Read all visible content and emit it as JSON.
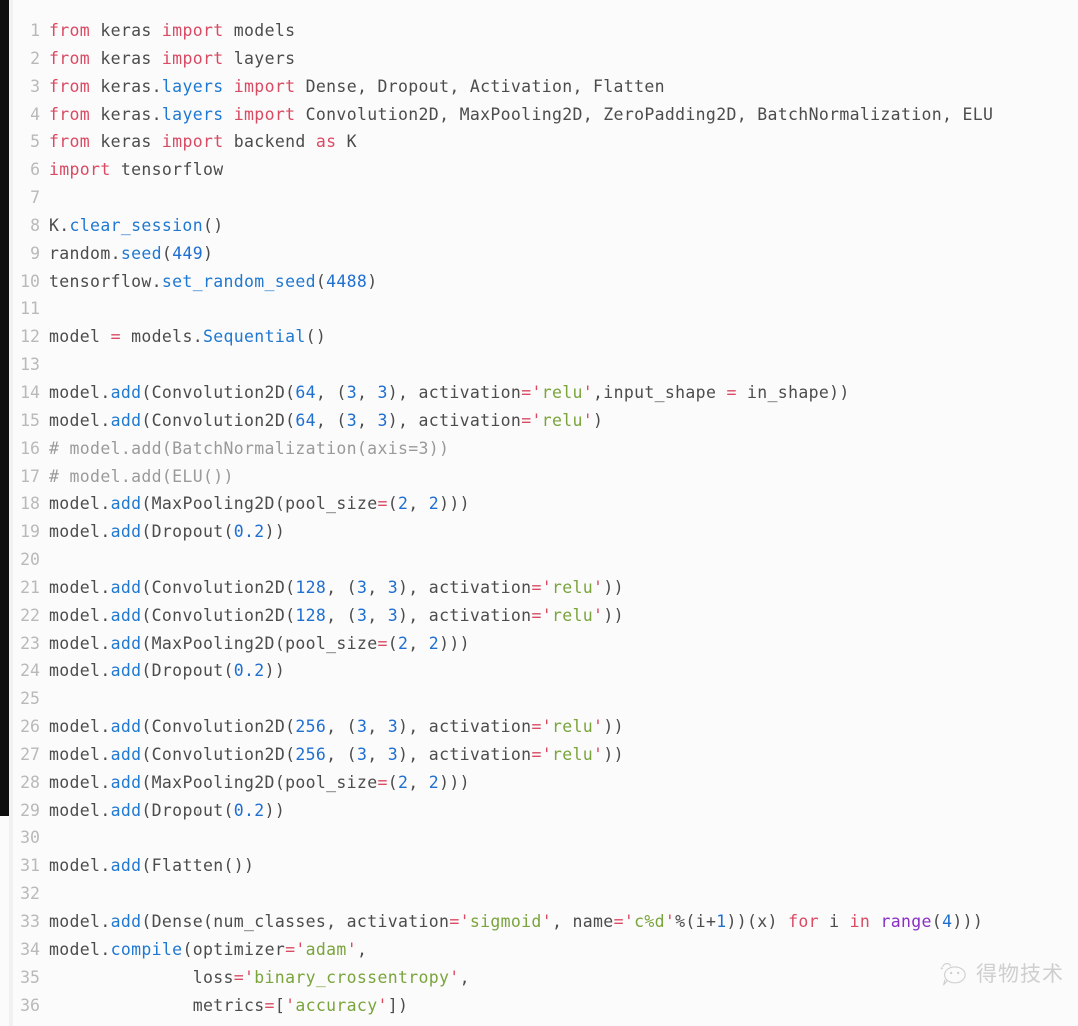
{
  "editor": {
    "language": "python",
    "theme_background": "#fbfbfb",
    "gutter_color": "#b9b9b9",
    "colors": {
      "keyword": "#d94a63",
      "function": "#1f78d1",
      "number": "#1f6fd1",
      "string": "#7aa43c",
      "comment": "#9a9a9a",
      "builtin": "#8a2fc4",
      "plain": "#4c4c4c",
      "left_bar": "#0e0e0e"
    },
    "first_line_number": 1,
    "last_line_number": 36,
    "total_lines": 36
  },
  "lines": [
    {
      "n": "1",
      "tokens": [
        {
          "t": "from",
          "c": "kw"
        },
        {
          "t": " keras ",
          "c": "pl"
        },
        {
          "t": "import",
          "c": "kw"
        },
        {
          "t": " models",
          "c": "pl"
        }
      ]
    },
    {
      "n": "2",
      "tokens": [
        {
          "t": "from",
          "c": "kw"
        },
        {
          "t": " keras ",
          "c": "pl"
        },
        {
          "t": "import",
          "c": "kw"
        },
        {
          "t": " layers",
          "c": "pl"
        }
      ]
    },
    {
      "n": "3",
      "tokens": [
        {
          "t": "from",
          "c": "kw"
        },
        {
          "t": " keras.",
          "c": "pl"
        },
        {
          "t": "layers",
          "c": "fn"
        },
        {
          "t": " ",
          "c": "pl"
        },
        {
          "t": "import",
          "c": "kw"
        },
        {
          "t": " Dense, Dropout, Activation, Flatten",
          "c": "pl"
        }
      ]
    },
    {
      "n": "4",
      "tokens": [
        {
          "t": "from",
          "c": "kw"
        },
        {
          "t": " keras.",
          "c": "pl"
        },
        {
          "t": "layers",
          "c": "fn"
        },
        {
          "t": " ",
          "c": "pl"
        },
        {
          "t": "import",
          "c": "kw"
        },
        {
          "t": " Convolution2D, MaxPooling2D, ZeroPadding2D, BatchNormalization, ELU",
          "c": "pl"
        }
      ]
    },
    {
      "n": "5",
      "tokens": [
        {
          "t": "from",
          "c": "kw"
        },
        {
          "t": " keras ",
          "c": "pl"
        },
        {
          "t": "import",
          "c": "kw"
        },
        {
          "t": " backend ",
          "c": "pl"
        },
        {
          "t": "as",
          "c": "kw"
        },
        {
          "t": " K",
          "c": "pl"
        }
      ]
    },
    {
      "n": "6",
      "tokens": [
        {
          "t": "import",
          "c": "kw"
        },
        {
          "t": " tensorflow",
          "c": "pl"
        }
      ]
    },
    {
      "n": "7",
      "tokens": []
    },
    {
      "n": "8",
      "tokens": [
        {
          "t": "K.",
          "c": "pl"
        },
        {
          "t": "clear_session",
          "c": "fn"
        },
        {
          "t": "()",
          "c": "pl"
        }
      ]
    },
    {
      "n": "9",
      "tokens": [
        {
          "t": "random.",
          "c": "pl"
        },
        {
          "t": "seed",
          "c": "fn"
        },
        {
          "t": "(",
          "c": "pl"
        },
        {
          "t": "449",
          "c": "num"
        },
        {
          "t": ")",
          "c": "pl"
        }
      ]
    },
    {
      "n": "10",
      "tokens": [
        {
          "t": "tensorflow.",
          "c": "pl"
        },
        {
          "t": "set_random_seed",
          "c": "fn"
        },
        {
          "t": "(",
          "c": "pl"
        },
        {
          "t": "4488",
          "c": "num"
        },
        {
          "t": ")",
          "c": "pl"
        }
      ]
    },
    {
      "n": "11",
      "tokens": []
    },
    {
      "n": "12",
      "tokens": [
        {
          "t": "model ",
          "c": "pl"
        },
        {
          "t": "=",
          "c": "op"
        },
        {
          "t": " models.",
          "c": "pl"
        },
        {
          "t": "Sequential",
          "c": "fn"
        },
        {
          "t": "()",
          "c": "pl"
        }
      ]
    },
    {
      "n": "13",
      "tokens": []
    },
    {
      "n": "14",
      "tokens": [
        {
          "t": "model.",
          "c": "pl"
        },
        {
          "t": "add",
          "c": "fn"
        },
        {
          "t": "(Convolution2D(",
          "c": "pl"
        },
        {
          "t": "64",
          "c": "num"
        },
        {
          "t": ", (",
          "c": "pl"
        },
        {
          "t": "3",
          "c": "num"
        },
        {
          "t": ", ",
          "c": "pl"
        },
        {
          "t": "3",
          "c": "num"
        },
        {
          "t": "), activation",
          "c": "pl"
        },
        {
          "t": "=",
          "c": "op"
        },
        {
          "t": "'",
          "c": "q"
        },
        {
          "t": "relu",
          "c": "str"
        },
        {
          "t": "'",
          "c": "q"
        },
        {
          "t": ",input_shape ",
          "c": "pl"
        },
        {
          "t": "=",
          "c": "op"
        },
        {
          "t": " in_shape))",
          "c": "pl"
        }
      ]
    },
    {
      "n": "15",
      "tokens": [
        {
          "t": "model.",
          "c": "pl"
        },
        {
          "t": "add",
          "c": "fn"
        },
        {
          "t": "(Convolution2D(",
          "c": "pl"
        },
        {
          "t": "64",
          "c": "num"
        },
        {
          "t": ", (",
          "c": "pl"
        },
        {
          "t": "3",
          "c": "num"
        },
        {
          "t": ", ",
          "c": "pl"
        },
        {
          "t": "3",
          "c": "num"
        },
        {
          "t": "), activation",
          "c": "pl"
        },
        {
          "t": "=",
          "c": "op"
        },
        {
          "t": "'",
          "c": "q"
        },
        {
          "t": "relu",
          "c": "str"
        },
        {
          "t": "'",
          "c": "q"
        },
        {
          "t": ")",
          "c": "pl"
        }
      ]
    },
    {
      "n": "16",
      "tokens": [
        {
          "t": "# model.add(BatchNormalization(axis=3))",
          "c": "com"
        }
      ]
    },
    {
      "n": "17",
      "tokens": [
        {
          "t": "# model.add(ELU())",
          "c": "com"
        }
      ]
    },
    {
      "n": "18",
      "tokens": [
        {
          "t": "model.",
          "c": "pl"
        },
        {
          "t": "add",
          "c": "fn"
        },
        {
          "t": "(MaxPooling2D(pool_size",
          "c": "pl"
        },
        {
          "t": "=",
          "c": "op"
        },
        {
          "t": "(",
          "c": "pl"
        },
        {
          "t": "2",
          "c": "num"
        },
        {
          "t": ", ",
          "c": "pl"
        },
        {
          "t": "2",
          "c": "num"
        },
        {
          "t": ")))",
          "c": "pl"
        }
      ]
    },
    {
      "n": "19",
      "tokens": [
        {
          "t": "model.",
          "c": "pl"
        },
        {
          "t": "add",
          "c": "fn"
        },
        {
          "t": "(Dropout(",
          "c": "pl"
        },
        {
          "t": "0.2",
          "c": "num"
        },
        {
          "t": "))",
          "c": "pl"
        }
      ]
    },
    {
      "n": "20",
      "tokens": []
    },
    {
      "n": "21",
      "tokens": [
        {
          "t": "model.",
          "c": "pl"
        },
        {
          "t": "add",
          "c": "fn"
        },
        {
          "t": "(Convolution2D(",
          "c": "pl"
        },
        {
          "t": "128",
          "c": "num"
        },
        {
          "t": ", (",
          "c": "pl"
        },
        {
          "t": "3",
          "c": "num"
        },
        {
          "t": ", ",
          "c": "pl"
        },
        {
          "t": "3",
          "c": "num"
        },
        {
          "t": "), activation",
          "c": "pl"
        },
        {
          "t": "=",
          "c": "op"
        },
        {
          "t": "'",
          "c": "q"
        },
        {
          "t": "relu",
          "c": "str"
        },
        {
          "t": "'",
          "c": "q"
        },
        {
          "t": "))",
          "c": "pl"
        }
      ]
    },
    {
      "n": "22",
      "tokens": [
        {
          "t": "model.",
          "c": "pl"
        },
        {
          "t": "add",
          "c": "fn"
        },
        {
          "t": "(Convolution2D(",
          "c": "pl"
        },
        {
          "t": "128",
          "c": "num"
        },
        {
          "t": ", (",
          "c": "pl"
        },
        {
          "t": "3",
          "c": "num"
        },
        {
          "t": ", ",
          "c": "pl"
        },
        {
          "t": "3",
          "c": "num"
        },
        {
          "t": "), activation",
          "c": "pl"
        },
        {
          "t": "=",
          "c": "op"
        },
        {
          "t": "'",
          "c": "q"
        },
        {
          "t": "relu",
          "c": "str"
        },
        {
          "t": "'",
          "c": "q"
        },
        {
          "t": "))",
          "c": "pl"
        }
      ]
    },
    {
      "n": "23",
      "tokens": [
        {
          "t": "model.",
          "c": "pl"
        },
        {
          "t": "add",
          "c": "fn"
        },
        {
          "t": "(MaxPooling2D(pool_size",
          "c": "pl"
        },
        {
          "t": "=",
          "c": "op"
        },
        {
          "t": "(",
          "c": "pl"
        },
        {
          "t": "2",
          "c": "num"
        },
        {
          "t": ", ",
          "c": "pl"
        },
        {
          "t": "2",
          "c": "num"
        },
        {
          "t": ")))",
          "c": "pl"
        }
      ]
    },
    {
      "n": "24",
      "tokens": [
        {
          "t": "model.",
          "c": "pl"
        },
        {
          "t": "add",
          "c": "fn"
        },
        {
          "t": "(Dropout(",
          "c": "pl"
        },
        {
          "t": "0.2",
          "c": "num"
        },
        {
          "t": "))",
          "c": "pl"
        }
      ]
    },
    {
      "n": "25",
      "tokens": []
    },
    {
      "n": "26",
      "tokens": [
        {
          "t": "model.",
          "c": "pl"
        },
        {
          "t": "add",
          "c": "fn"
        },
        {
          "t": "(Convolution2D(",
          "c": "pl"
        },
        {
          "t": "256",
          "c": "num"
        },
        {
          "t": ", (",
          "c": "pl"
        },
        {
          "t": "3",
          "c": "num"
        },
        {
          "t": ", ",
          "c": "pl"
        },
        {
          "t": "3",
          "c": "num"
        },
        {
          "t": "), activation",
          "c": "pl"
        },
        {
          "t": "=",
          "c": "op"
        },
        {
          "t": "'",
          "c": "q"
        },
        {
          "t": "relu",
          "c": "str"
        },
        {
          "t": "'",
          "c": "q"
        },
        {
          "t": "))",
          "c": "pl"
        }
      ]
    },
    {
      "n": "27",
      "tokens": [
        {
          "t": "model.",
          "c": "pl"
        },
        {
          "t": "add",
          "c": "fn"
        },
        {
          "t": "(Convolution2D(",
          "c": "pl"
        },
        {
          "t": "256",
          "c": "num"
        },
        {
          "t": ", (",
          "c": "pl"
        },
        {
          "t": "3",
          "c": "num"
        },
        {
          "t": ", ",
          "c": "pl"
        },
        {
          "t": "3",
          "c": "num"
        },
        {
          "t": "), activation",
          "c": "pl"
        },
        {
          "t": "=",
          "c": "op"
        },
        {
          "t": "'",
          "c": "q"
        },
        {
          "t": "relu",
          "c": "str"
        },
        {
          "t": "'",
          "c": "q"
        },
        {
          "t": "))",
          "c": "pl"
        }
      ]
    },
    {
      "n": "28",
      "tokens": [
        {
          "t": "model.",
          "c": "pl"
        },
        {
          "t": "add",
          "c": "fn"
        },
        {
          "t": "(MaxPooling2D(pool_size",
          "c": "pl"
        },
        {
          "t": "=",
          "c": "op"
        },
        {
          "t": "(",
          "c": "pl"
        },
        {
          "t": "2",
          "c": "num"
        },
        {
          "t": ", ",
          "c": "pl"
        },
        {
          "t": "2",
          "c": "num"
        },
        {
          "t": ")))",
          "c": "pl"
        }
      ]
    },
    {
      "n": "29",
      "tokens": [
        {
          "t": "model.",
          "c": "pl"
        },
        {
          "t": "add",
          "c": "fn"
        },
        {
          "t": "(Dropout(",
          "c": "pl"
        },
        {
          "t": "0.2",
          "c": "num"
        },
        {
          "t": "))",
          "c": "pl"
        }
      ]
    },
    {
      "n": "30",
      "tokens": []
    },
    {
      "n": "31",
      "tokens": [
        {
          "t": "model.",
          "c": "pl"
        },
        {
          "t": "add",
          "c": "fn"
        },
        {
          "t": "(Flatten())",
          "c": "pl"
        }
      ]
    },
    {
      "n": "32",
      "tokens": []
    },
    {
      "n": "33",
      "tokens": [
        {
          "t": "model.",
          "c": "pl"
        },
        {
          "t": "add",
          "c": "fn"
        },
        {
          "t": "(Dense(num_classes, activation",
          "c": "pl"
        },
        {
          "t": "=",
          "c": "op"
        },
        {
          "t": "'",
          "c": "q"
        },
        {
          "t": "sigmoid",
          "c": "str"
        },
        {
          "t": "'",
          "c": "q"
        },
        {
          "t": ", name",
          "c": "pl"
        },
        {
          "t": "=",
          "c": "op"
        },
        {
          "t": "'",
          "c": "q"
        },
        {
          "t": "c%d",
          "c": "str"
        },
        {
          "t": "'",
          "c": "q"
        },
        {
          "t": "%(i+",
          "c": "pl"
        },
        {
          "t": "1",
          "c": "num"
        },
        {
          "t": "))(x) ",
          "c": "pl"
        },
        {
          "t": "for",
          "c": "kw"
        },
        {
          "t": " i ",
          "c": "pl"
        },
        {
          "t": "in",
          "c": "kw"
        },
        {
          "t": " ",
          "c": "pl"
        },
        {
          "t": "range",
          "c": "bi"
        },
        {
          "t": "(",
          "c": "pl"
        },
        {
          "t": "4",
          "c": "num"
        },
        {
          "t": ")))",
          "c": "pl"
        }
      ]
    },
    {
      "n": "34",
      "tokens": [
        {
          "t": "model.",
          "c": "pl"
        },
        {
          "t": "compile",
          "c": "fn"
        },
        {
          "t": "(optimizer",
          "c": "pl"
        },
        {
          "t": "=",
          "c": "op"
        },
        {
          "t": "'",
          "c": "q"
        },
        {
          "t": "adam",
          "c": "str"
        },
        {
          "t": "'",
          "c": "q"
        },
        {
          "t": ",",
          "c": "pl"
        }
      ]
    },
    {
      "n": "35",
      "tokens": [
        {
          "t": "              loss",
          "c": "pl"
        },
        {
          "t": "=",
          "c": "op"
        },
        {
          "t": "'",
          "c": "q"
        },
        {
          "t": "binary_crossentropy",
          "c": "str"
        },
        {
          "t": "'",
          "c": "q"
        },
        {
          "t": ",",
          "c": "pl"
        }
      ]
    },
    {
      "n": "36",
      "tokens": [
        {
          "t": "              metrics",
          "c": "pl"
        },
        {
          "t": "=",
          "c": "op"
        },
        {
          "t": "[",
          "c": "pl"
        },
        {
          "t": "'",
          "c": "q"
        },
        {
          "t": "accuracy",
          "c": "str"
        },
        {
          "t": "'",
          "c": "q"
        },
        {
          "t": "])",
          "c": "pl"
        }
      ]
    }
  ],
  "watermark": {
    "text": "得物技术",
    "logo": "speech-bubble-face-logo"
  }
}
